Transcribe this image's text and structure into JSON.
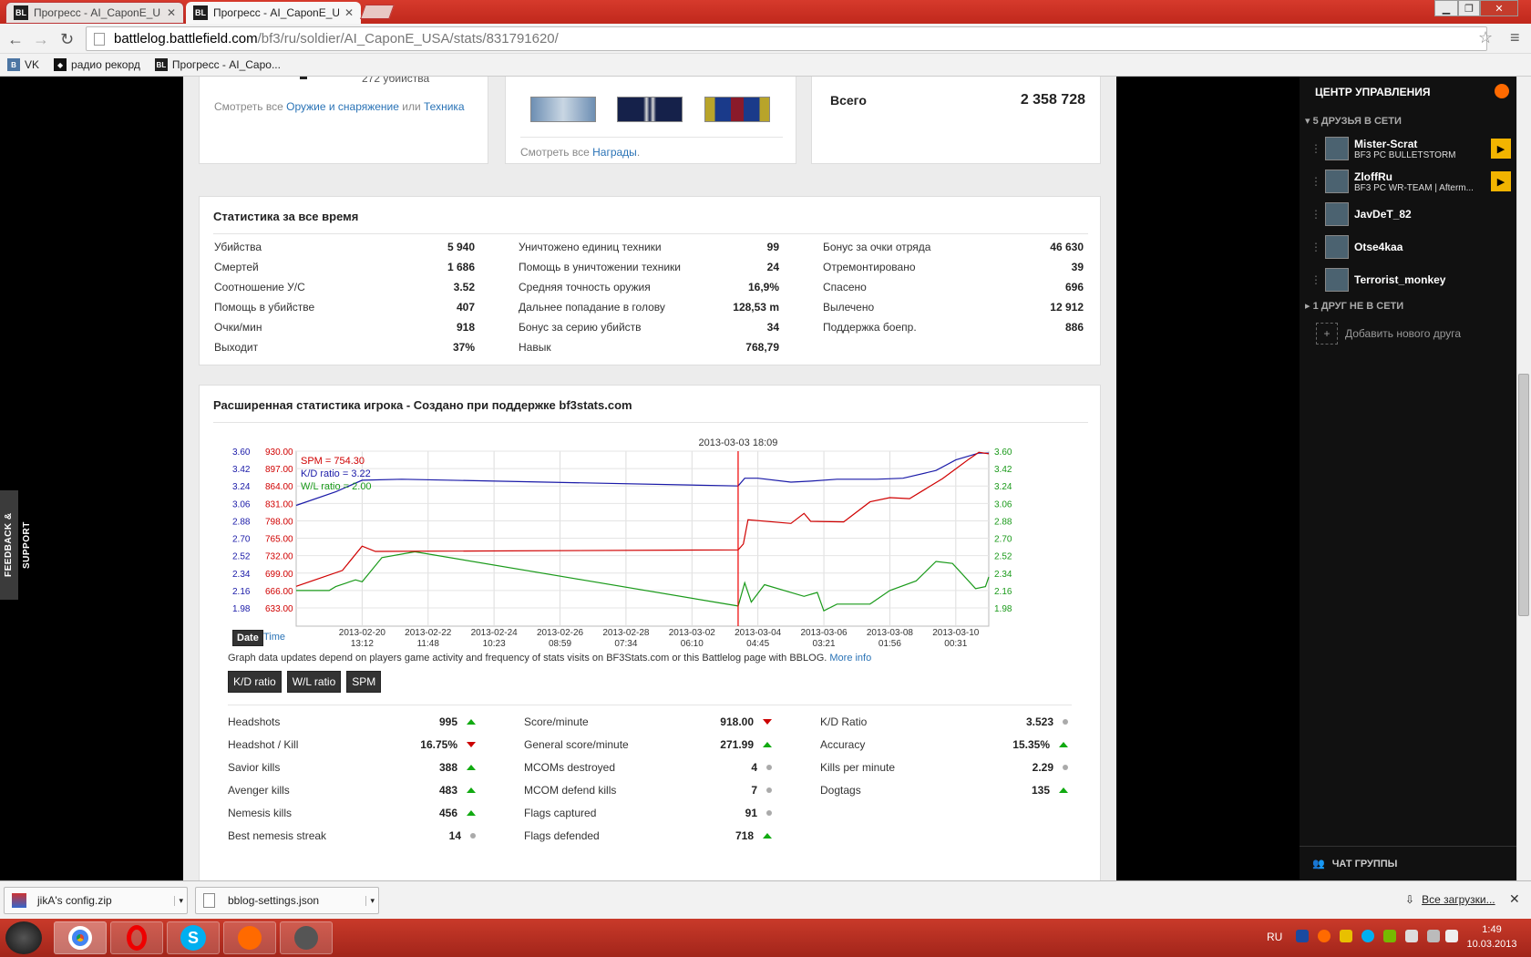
{
  "tabs": [
    {
      "title": "Прогресс - AI_CaponE_US",
      "favicon": "BL"
    },
    {
      "title": "Прогресс - AI_CaponE_US",
      "favicon": "BL"
    }
  ],
  "address": {
    "host": "battlelog.battlefield.com",
    "path": "/bf3/ru/soldier/AI_CaponE_USA/stats/831791620/"
  },
  "bookmarks": [
    {
      "label": "VK"
    },
    {
      "label": "радио рекорд"
    },
    {
      "label": "Прогресс - AI_Capo..."
    }
  ],
  "top_cards": {
    "weapons_text": "272 убийства",
    "weapons_prefix": "Смотреть все ",
    "weapons_link": "Оружие и снаряжение",
    "weapons_or": " или ",
    "vehicles_link": "Техника",
    "awards_prefix": "Смотреть все ",
    "awards_link": "Награды",
    "awards_suffix": ".",
    "total_label": "Всего",
    "total_value": "2 358 728"
  },
  "alltime": {
    "title": "Статистика за все время",
    "col1": [
      {
        "label": "Убийства",
        "value": "5 940"
      },
      {
        "label": "Смертей",
        "value": "1 686"
      },
      {
        "label": "Соотношение У/С",
        "value": "3.52"
      },
      {
        "label": "Помощь в убийстве",
        "value": "407"
      },
      {
        "label": "Очки/мин",
        "value": "918"
      },
      {
        "label": "Выходит",
        "value": "37%"
      }
    ],
    "col2": [
      {
        "label": "Уничтожено единиц техники",
        "value": "99"
      },
      {
        "label": "Помощь в уничтожении техники",
        "value": "24"
      },
      {
        "label": "Средняя точность оружия",
        "value": "16,9%"
      },
      {
        "label": "Дальнее попадание в голову",
        "value": "128,53 m"
      },
      {
        "label": "Бонус за серию убийств",
        "value": "34"
      },
      {
        "label": "Навык",
        "value": "768,79"
      }
    ],
    "col3": [
      {
        "label": "Бонус за очки отряда",
        "value": "46 630"
      },
      {
        "label": "Отремонтировано",
        "value": "39"
      },
      {
        "label": "Спасено",
        "value": "696"
      },
      {
        "label": "Вылечено",
        "value": "12 912"
      },
      {
        "label": "Поддержка боепр.",
        "value": "886"
      }
    ]
  },
  "extended": {
    "title": "Расширенная статистика игрока - Создано при поддержке bf3stats.com",
    "chart_note": "Graph data updates depend on players game activity and frequency of stats visits on BF3Stats.com or this Battlelog page with BBLOG.",
    "more_info": "More info",
    "date_btn": "Date",
    "time_btn": "Time",
    "toggles": [
      {
        "label": "K/D ratio"
      },
      {
        "label": "W/L ratio"
      },
      {
        "label": "SPM"
      }
    ],
    "col1": [
      {
        "label": "Headshots",
        "value": "995",
        "trend": "up"
      },
      {
        "label": "Headshot / Kill",
        "value": "16.75%",
        "trend": "down"
      },
      {
        "label": "Savior kills",
        "value": "388",
        "trend": "up"
      },
      {
        "label": "Avenger kills",
        "value": "483",
        "trend": "up"
      },
      {
        "label": "Nemesis kills",
        "value": "456",
        "trend": "up"
      },
      {
        "label": "Best nemesis streak",
        "value": "14",
        "trend": "flat"
      }
    ],
    "col2": [
      {
        "label": "Score/minute",
        "value": "918.00",
        "trend": "down"
      },
      {
        "label": "General score/minute",
        "value": "271.99",
        "trend": "up"
      },
      {
        "label": "MCOMs destroyed",
        "value": "4",
        "trend": "flat"
      },
      {
        "label": "MCOM defend kills",
        "value": "7",
        "trend": "flat"
      },
      {
        "label": "Flags captured",
        "value": "91",
        "trend": "flat"
      },
      {
        "label": "Flags defended",
        "value": "718",
        "trend": "up"
      }
    ],
    "col3": [
      {
        "label": "K/D Ratio",
        "value": "3.523",
        "trend": "flat"
      },
      {
        "label": "Accuracy",
        "value": "15.35%",
        "trend": "up"
      },
      {
        "label": "Kills per minute",
        "value": "2.29",
        "trend": "flat"
      },
      {
        "label": "Dogtags",
        "value": "135",
        "trend": "up"
      }
    ]
  },
  "chart_data": {
    "type": "line",
    "cursor_label": "2013-03-03 18:09",
    "legend": [
      {
        "name": "SPM = 754.30",
        "color": "#d00000"
      },
      {
        "name": "K/D ratio = 3.22",
        "color": "#1a1aa8"
      },
      {
        "name": "W/L ratio = 2.00",
        "color": "#1a9a1a"
      }
    ],
    "left_ticks_kd": [
      "3.60",
      "3.42",
      "3.24",
      "3.06",
      "2.88",
      "2.70",
      "2.52",
      "2.34",
      "2.16",
      "1.98"
    ],
    "left_ticks_spm": [
      "930.00",
      "897.00",
      "864.00",
      "831.00",
      "798.00",
      "765.00",
      "732.00",
      "699.00",
      "666.00",
      "633.00"
    ],
    "right_ticks": [
      "3.60",
      "3.42",
      "3.24",
      "3.06",
      "2.88",
      "2.70",
      "2.52",
      "2.34",
      "2.16",
      "1.98"
    ],
    "x_ticks": [
      {
        "date": "2013-02-20",
        "time": "13:12"
      },
      {
        "date": "2013-02-22",
        "time": "11:48"
      },
      {
        "date": "2013-02-24",
        "time": "10:23"
      },
      {
        "date": "2013-02-26",
        "time": "08:59"
      },
      {
        "date": "2013-02-28",
        "time": "07:34"
      },
      {
        "date": "2013-03-02",
        "time": "06:10"
      },
      {
        "date": "2013-03-04",
        "time": "04:45"
      },
      {
        "date": "2013-03-06",
        "time": "03:21"
      },
      {
        "date": "2013-03-08",
        "time": "01:56"
      },
      {
        "date": "2013-03-10",
        "time": "00:31"
      }
    ],
    "series": [
      {
        "name": "K/D ratio",
        "color": "#1a1aa8",
        "points": [
          [
            0,
            3.04
          ],
          [
            0.6,
            3.18
          ],
          [
            1.0,
            3.3
          ],
          [
            1.6,
            3.31
          ],
          [
            6.7,
            3.24
          ],
          [
            6.8,
            3.32
          ],
          [
            7.0,
            3.32
          ],
          [
            7.5,
            3.28
          ],
          [
            7.8,
            3.29
          ],
          [
            8.2,
            3.31
          ],
          [
            8.8,
            3.31
          ],
          [
            9.2,
            3.32
          ],
          [
            9.7,
            3.4
          ],
          [
            10.0,
            3.51
          ],
          [
            10.35,
            3.58
          ],
          [
            10.5,
            3.58
          ]
        ]
      },
      {
        "name": "W/L ratio",
        "color": "#1a9a1a",
        "points": [
          [
            0,
            2.16
          ],
          [
            0.5,
            2.16
          ],
          [
            0.6,
            2.2
          ],
          [
            0.9,
            2.27
          ],
          [
            1.0,
            2.25
          ],
          [
            1.3,
            2.5
          ],
          [
            1.8,
            2.56
          ],
          [
            6.7,
            2.0
          ],
          [
            6.8,
            2.24
          ],
          [
            6.9,
            2.04
          ],
          [
            7.1,
            2.22
          ],
          [
            7.7,
            2.1
          ],
          [
            7.9,
            2.14
          ],
          [
            8.0,
            1.95
          ],
          [
            8.2,
            2.02
          ],
          [
            8.7,
            2.02
          ],
          [
            9.0,
            2.16
          ],
          [
            9.4,
            2.26
          ],
          [
            9.7,
            2.46
          ],
          [
            9.95,
            2.44
          ],
          [
            10.3,
            2.18
          ],
          [
            10.45,
            2.2
          ],
          [
            10.5,
            2.3
          ]
        ]
      },
      {
        "name": "SPM",
        "color": "#d00000",
        "points": [
          [
            0,
            674
          ],
          [
            0.7,
            704
          ],
          [
            1.0,
            750
          ],
          [
            1.2,
            740
          ],
          [
            6.7,
            743
          ],
          [
            6.78,
            754
          ],
          [
            6.85,
            800
          ],
          [
            7.5,
            793
          ],
          [
            7.7,
            812
          ],
          [
            7.8,
            797
          ],
          [
            8.3,
            796
          ],
          [
            8.7,
            834
          ],
          [
            9.0,
            842
          ],
          [
            9.3,
            840
          ],
          [
            9.8,
            878
          ],
          [
            10.2,
            915
          ],
          [
            10.35,
            928
          ],
          [
            10.5,
            925
          ]
        ]
      }
    ],
    "xlim": [
      0,
      10.5
    ],
    "ylim_kd": [
      1.98,
      3.6
    ],
    "ylim_spm": [
      633,
      930
    ],
    "cursor_x": 6.7
  },
  "sidebar": {
    "title": "ЦЕНТР УПРАВЛЕНИЯ",
    "online_header": "5 ДРУЗЬЯ В СЕТИ",
    "friends": [
      {
        "name": "Mister-Scrat",
        "sub": "BF3 PC BULLETSTORM",
        "play": true
      },
      {
        "name": "ZloffRu",
        "sub": "BF3 PC WR-TEAM | Afterm...",
        "play": true
      },
      {
        "name": "JavDeT_82",
        "sub": "",
        "play": false
      },
      {
        "name": "Otse4kaa",
        "sub": "",
        "play": false
      },
      {
        "name": "Terrorist_monkey",
        "sub": "",
        "play": false
      }
    ],
    "offline_header": "1 ДРУГ НЕ В СЕТИ",
    "add_friend": "Добавить нового друга",
    "group_chat": "ЧАТ ГРУППЫ"
  },
  "feedback": "FEEDBACK & SUPPORT",
  "downloads": {
    "items": [
      {
        "name": "jikA's config.zip"
      },
      {
        "name": "bblog-settings.json"
      }
    ],
    "all": "Все загрузки..."
  },
  "taskbar": {
    "lang": "RU",
    "time": "1:49",
    "date": "10.03.2013"
  }
}
